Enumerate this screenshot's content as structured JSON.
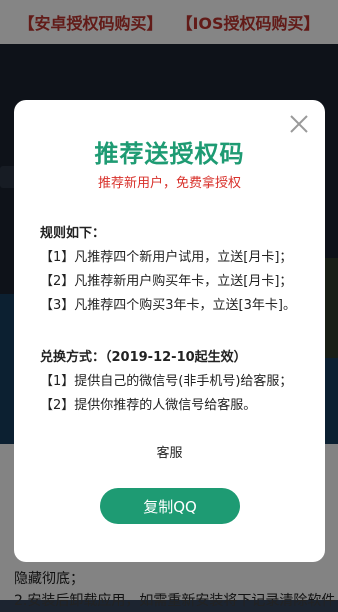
{
  "topbar": {
    "android_link": "【安卓授权码购买】",
    "ios_link": "【IOS授权码购买】"
  },
  "background": {
    "text_line_1": "隐藏彻底；",
    "text_line_2": "2.安装后卸载应用，如需重新安装将下记录清除软件"
  },
  "modal": {
    "title": "推荐送授权码",
    "subtitle": "推荐新用户，免费拿授权",
    "rules": {
      "heading": "规则如下：",
      "items": [
        "【1】凡推荐四个新用户试用，立送[月卡]；",
        "【2】凡推荐新用户购买年卡，立送[月卡]；",
        "【3】凡推荐四个购买3年卡，立送[3年卡]。"
      ]
    },
    "redeem": {
      "heading": "兑换方式：（2019-12-10起生效）",
      "items": [
        "【1】提供自己的微信号(非手机号)给客服；",
        "【2】提供你推荐的人微信号给客服。"
      ]
    },
    "contact_label": "客服",
    "copy_button": "复制QQ"
  }
}
